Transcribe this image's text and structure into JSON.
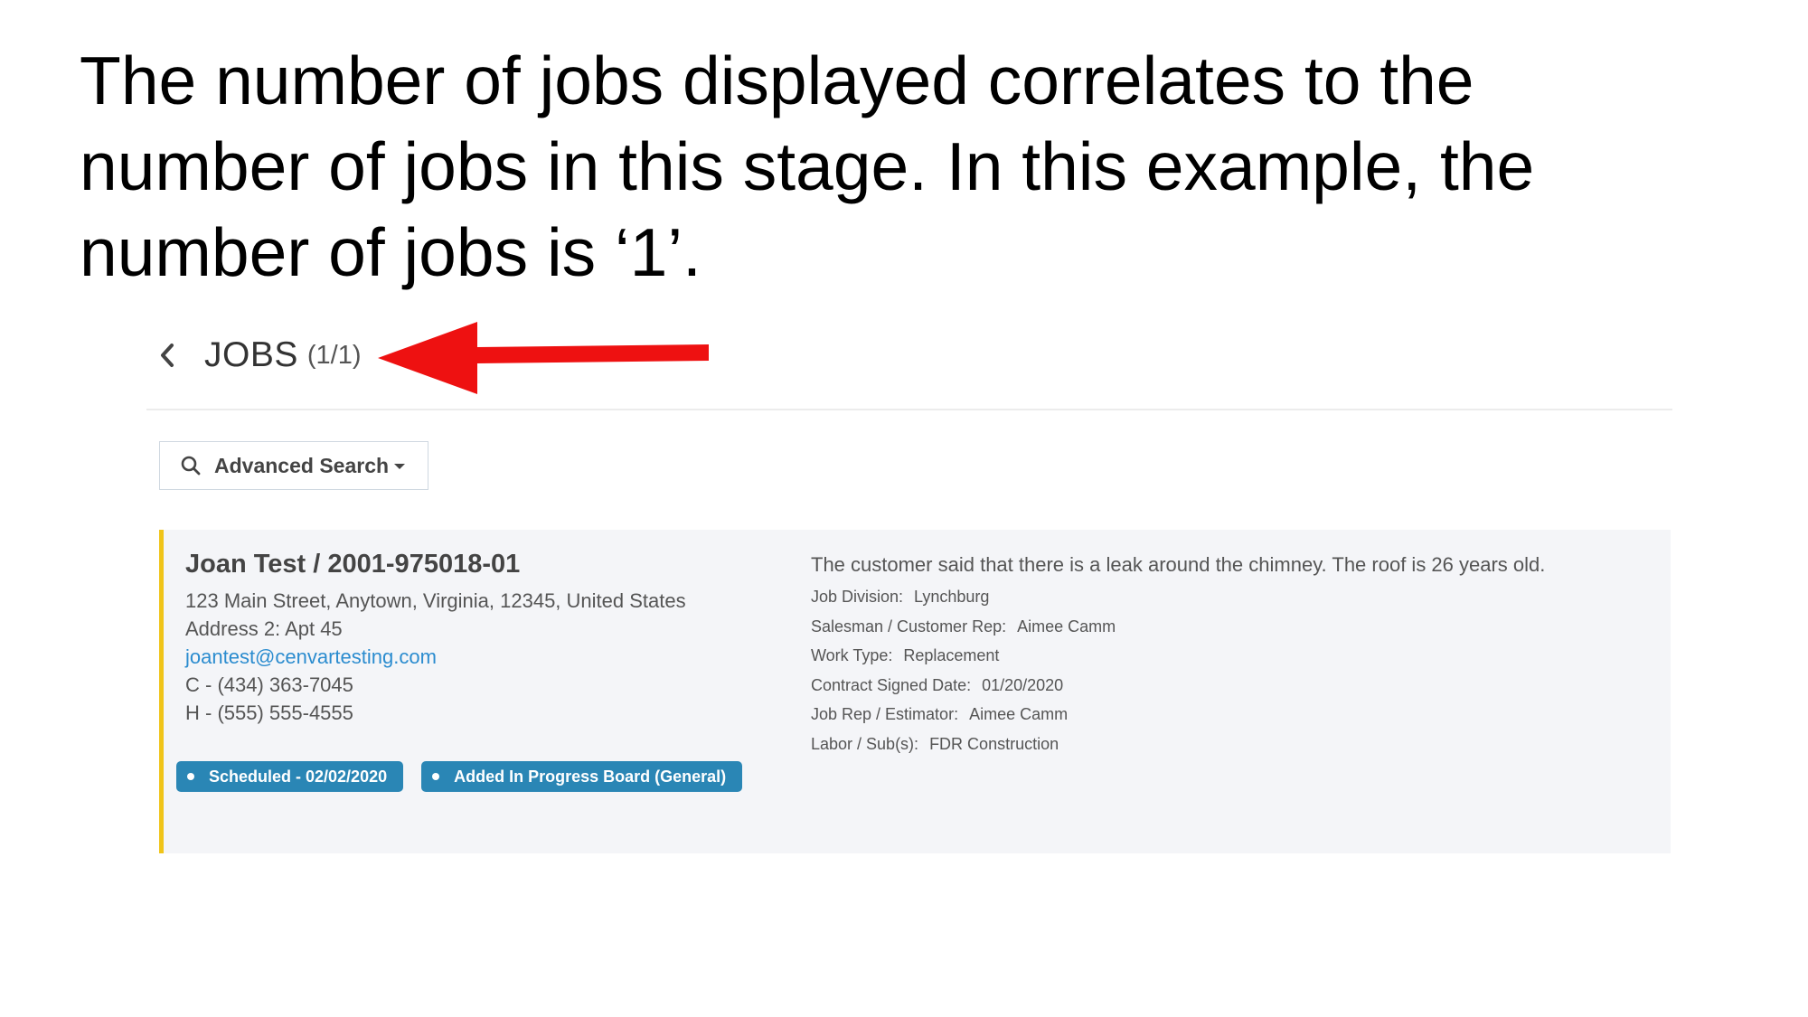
{
  "caption": {
    "line1": "The number of jobs displayed correlates to the",
    "line2": "number of jobs in this stage.  In this example, the",
    "line3": "number of jobs is ‘1’."
  },
  "header": {
    "back_icon": "chevron-left-icon",
    "title": "JOBS",
    "count": "(1/1)"
  },
  "annotation": {
    "arrow_color": "#ee1111"
  },
  "search": {
    "icon": "search-icon",
    "label": "Advanced Search",
    "caret_icon": "caret-down-icon"
  },
  "job": {
    "accent_color": "#f0c419",
    "name": "Joan Test / 2001-975018-01",
    "address": "123 Main Street, Anytown, Virginia, 12345, United States",
    "address2": "Address 2: Apt 45",
    "email": "joantest@cenvartesting.com",
    "cell": "C - (434) 363-7045",
    "home": "H - (555) 555-4555",
    "badges": [
      "Scheduled - 02/02/2020",
      "Added In Progress Board (General)"
    ],
    "badge_color": "#2a86b5",
    "notes": "The customer said that there is a leak around the chimney. The roof is 26 years old.",
    "details": [
      {
        "label": "Job Division:",
        "value": "Lynchburg"
      },
      {
        "label": "Salesman / Customer Rep:",
        "value": "Aimee Camm"
      },
      {
        "label": "Work Type:",
        "value": "Replacement"
      },
      {
        "label": "Contract Signed Date:",
        "value": "01/20/2020"
      },
      {
        "label": "Job Rep / Estimator:",
        "value": "Aimee Camm"
      },
      {
        "label": "Labor / Sub(s):",
        "value": "FDR Construction"
      }
    ]
  }
}
